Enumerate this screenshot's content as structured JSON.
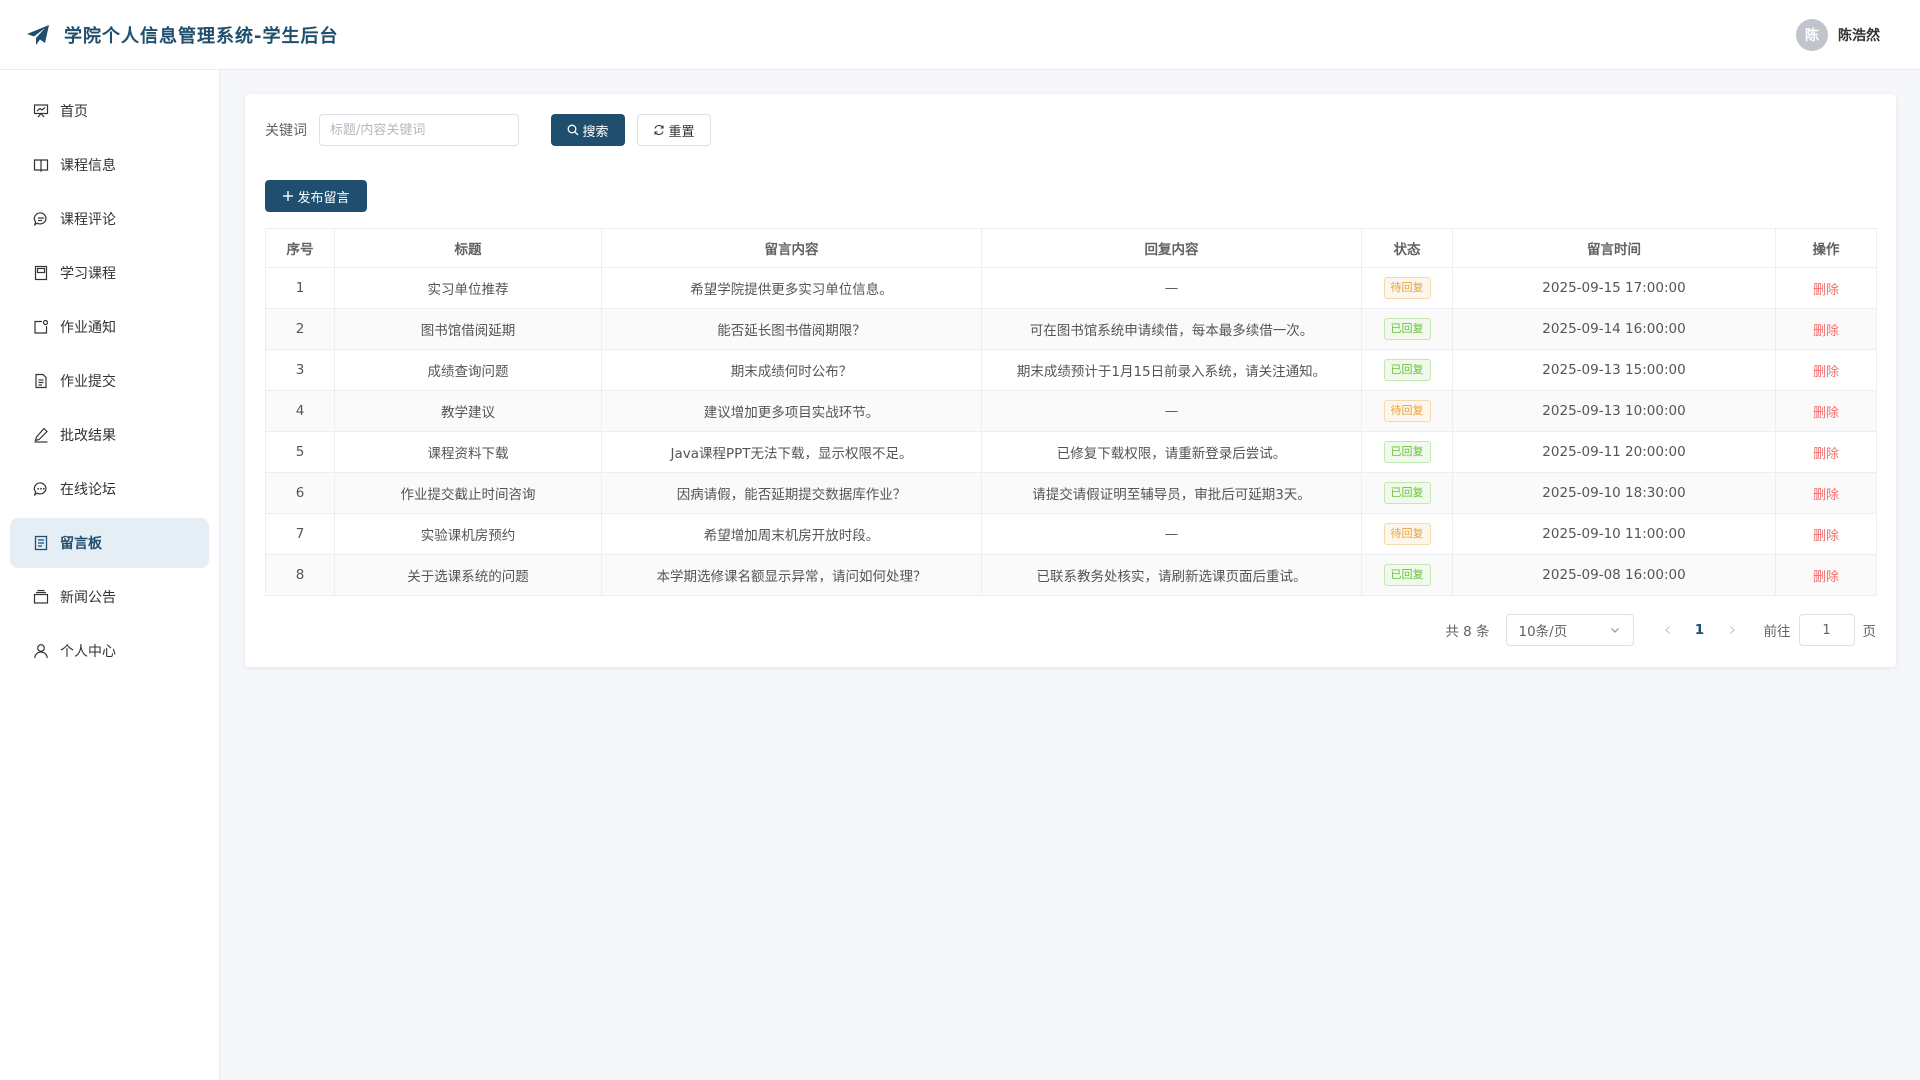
{
  "header": {
    "title": "学院个人信息管理系统-学生后台",
    "user_name": "陈浩然",
    "avatar_text": "陈"
  },
  "sidebar": {
    "items": [
      {
        "label": "首页",
        "icon": "dashboard-icon"
      },
      {
        "label": "课程信息",
        "icon": "book-icon"
      },
      {
        "label": "课程评论",
        "icon": "comment-icon"
      },
      {
        "label": "学习课程",
        "icon": "notebook-icon"
      },
      {
        "label": "作业通知",
        "icon": "notification-icon"
      },
      {
        "label": "作业提交",
        "icon": "document-icon"
      },
      {
        "label": "批改结果",
        "icon": "edit-pen-icon"
      },
      {
        "label": "在线论坛",
        "icon": "chat-dots-icon"
      },
      {
        "label": "留言板",
        "icon": "tickets-icon",
        "active": true
      },
      {
        "label": "新闻公告",
        "icon": "box-icon"
      },
      {
        "label": "个人中心",
        "icon": "user-icon"
      }
    ]
  },
  "search": {
    "label": "关键词",
    "placeholder": "标题/内容关键词",
    "value": "",
    "search_button": "搜索",
    "reset_button": "重置"
  },
  "publish_button": "发布留言",
  "table": {
    "columns": [
      "序号",
      "标题",
      "留言内容",
      "回复内容",
      "状态",
      "留言时间",
      "操作"
    ],
    "rows": [
      {
        "no": "1",
        "title": "实习单位推荐",
        "content": "希望学院提供更多实习单位信息。",
        "reply": "—",
        "status": "待回复",
        "time": "2025-09-15 17:00:00",
        "action": "删除"
      },
      {
        "no": "2",
        "title": "图书馆借阅延期",
        "content": "能否延长图书借阅期限？",
        "reply": "可在图书馆系统申请续借，每本最多续借一次。",
        "status": "已回复",
        "time": "2025-09-14 16:00:00",
        "action": "删除"
      },
      {
        "no": "3",
        "title": "成绩查询问题",
        "content": "期末成绩何时公布？",
        "reply": "期末成绩预计于1月15日前录入系统，请关注通知。",
        "status": "已回复",
        "time": "2025-09-13 15:00:00",
        "action": "删除"
      },
      {
        "no": "4",
        "title": "教学建议",
        "content": "建议增加更多项目实战环节。",
        "reply": "—",
        "status": "待回复",
        "time": "2025-09-13 10:00:00",
        "action": "删除"
      },
      {
        "no": "5",
        "title": "课程资料下载",
        "content": "Java课程PPT无法下载，显示权限不足。",
        "reply": "已修复下载权限，请重新登录后尝试。",
        "status": "已回复",
        "time": "2025-09-11 20:00:00",
        "action": "删除"
      },
      {
        "no": "6",
        "title": "作业提交截止时间咨询",
        "content": "因病请假，能否延期提交数据库作业？",
        "reply": "请提交请假证明至辅导员，审批后可延期3天。",
        "status": "已回复",
        "time": "2025-09-10 18:30:00",
        "action": "删除"
      },
      {
        "no": "7",
        "title": "实验课机房预约",
        "content": "希望增加周末机房开放时段。",
        "reply": "—",
        "status": "待回复",
        "time": "2025-09-10 11:00:00",
        "action": "删除"
      },
      {
        "no": "8",
        "title": "关于选课系统的问题",
        "content": "本学期选修课名额显示异常，请问如何处理？",
        "reply": "已联系教务处核实，请刷新选课页面后重试。",
        "status": "已回复",
        "time": "2025-09-08 16:00:00",
        "action": "删除"
      }
    ]
  },
  "pagination": {
    "total_text": "共 8 条",
    "page_size": "10条/页",
    "current_page": "1",
    "goto_label": "前往",
    "goto_value": "1",
    "goto_suffix": "页"
  },
  "colors": {
    "primary": "#1f4e6e",
    "pending": "#e6a23c",
    "replied": "#67c23a",
    "danger": "#f56c6c"
  }
}
